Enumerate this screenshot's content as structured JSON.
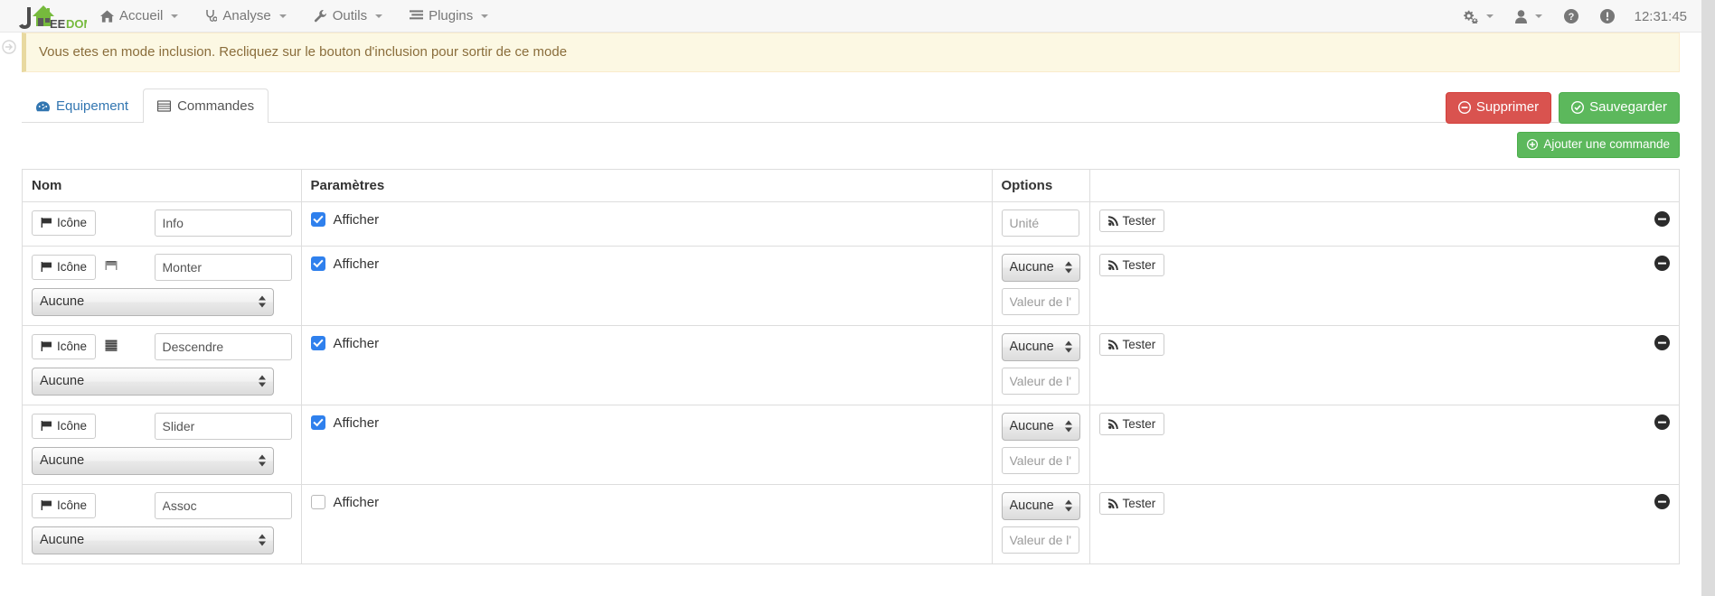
{
  "navbar": {
    "brand": "JEEDOM",
    "items": [
      {
        "label": "Accueil",
        "icon": "home-icon",
        "caret": true
      },
      {
        "label": "Analyse",
        "icon": "stethoscope-icon",
        "caret": true
      },
      {
        "label": "Outils",
        "icon": "wrench-icon",
        "caret": true
      },
      {
        "label": "Plugins",
        "icon": "list-icon",
        "caret": true
      }
    ],
    "right": [
      {
        "name": "gears-icon",
        "caret": true
      },
      {
        "name": "user-icon",
        "caret": true
      },
      {
        "name": "help-icon",
        "caret": false
      },
      {
        "name": "info-icon",
        "caret": false
      }
    ],
    "clock": "12:31:45"
  },
  "sidebar_toggle": {
    "icon": "arrow-circle-right-icon"
  },
  "alert": {
    "text": "Vous etes en mode inclusion. Recliquez sur le bouton d'inclusion pour sortir de ce mode"
  },
  "tabs": [
    {
      "label": "Equipement",
      "icon": "dashboard-icon",
      "active": false
    },
    {
      "label": "Commandes",
      "icon": "table-icon",
      "active": true
    }
  ],
  "top_actions": {
    "delete_label": "Supprimer",
    "delete_icon": "minus-circle-icon",
    "save_label": "Sauvegarder",
    "save_icon": "check-circle-icon"
  },
  "add_command": {
    "label": "Ajouter une commande",
    "icon": "plus-circle-icon"
  },
  "table": {
    "headers": [
      "Nom",
      "Paramètres",
      "Options",
      ""
    ],
    "icon_button_label": "Icône",
    "icon_button_icon": "flag-icon",
    "show_label": "Afficher",
    "test_label": "Tester",
    "test_icon": "rss-icon",
    "delete_icon": "minus-circle-icon",
    "rows": [
      {
        "name": "Info",
        "type_icon": null,
        "has_subselect": false,
        "subselect_value": null,
        "show_checked": true,
        "option_kind": "input",
        "option_placeholder": "Unité",
        "option_select_value": null,
        "value_placeholder": null
      },
      {
        "name": "Monter",
        "type_icon": "blind-open-icon",
        "has_subselect": true,
        "subselect_value": "Aucune",
        "show_checked": true,
        "option_kind": "select",
        "option_placeholder": null,
        "option_select_value": "Aucune",
        "value_placeholder": "Valeur de l'info"
      },
      {
        "name": "Descendre",
        "type_icon": "blind-closed-icon",
        "has_subselect": true,
        "subselect_value": "Aucune",
        "show_checked": true,
        "option_kind": "select",
        "option_placeholder": null,
        "option_select_value": "Aucune",
        "value_placeholder": "Valeur de l'info"
      },
      {
        "name": "Slider",
        "type_icon": null,
        "has_subselect": true,
        "subselect_value": "Aucune",
        "show_checked": true,
        "option_kind": "select",
        "option_placeholder": null,
        "option_select_value": "Aucune",
        "value_placeholder": "Valeur de l'info"
      },
      {
        "name": "Assoc",
        "type_icon": null,
        "has_subselect": true,
        "subselect_value": "Aucune",
        "show_checked": false,
        "option_kind": "select",
        "option_placeholder": null,
        "option_select_value": "Aucune",
        "value_placeholder": "Valeur de l'info"
      }
    ]
  },
  "colors": {
    "brand_green": "#76ba3d",
    "danger": "#d9534f",
    "success": "#5cb85c",
    "link": "#3276b1",
    "alert_bg": "#fcf8e3",
    "alert_text": "#8a6d3b",
    "checkbox_blue": "#2f80ed"
  }
}
